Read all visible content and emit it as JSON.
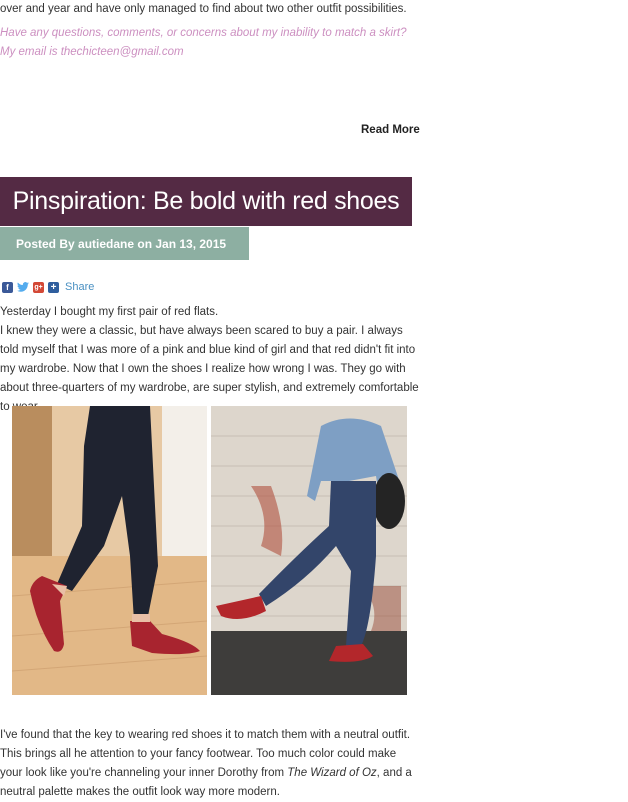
{
  "previous_post": {
    "text_tail": "over and year and have only managed to find about two other outfit possibilities.",
    "contact_text": "Have any questions, comments, or concerns about my inability to match a skirt? My email is thechicteen@gmail.com",
    "read_more_label": "Read More"
  },
  "post": {
    "title": "Pinspiration: Be bold with red shoes",
    "posted_by": "Posted By autiedane on Jan 13, 2015",
    "share": {
      "label": "Share",
      "icons": [
        "facebook-icon",
        "twitter-icon",
        "google-plus-icon",
        "addthis-plus-icon"
      ]
    },
    "body": [
      "Yesterday I bought my first pair of red flats.",
      "I knew they were a classic, but have always been scared to buy a pair. I always told myself that I was more of a pink and blue kind of girl and that red didn't fit into my wardrobe. Now that I own the shoes I realize how wrong I was. They go with about three-quarters of my wardrobe, are super stylish, and extremely comfortable to wear."
    ],
    "closing": {
      "before_title": "I've found that the key to wearing red shoes it to match them with a neutral outfit. This brings all he attention to your fancy footwear. Too much color could make your look like you're channeling your inner Dorothy from ",
      "movie_title": "The Wizard of Oz",
      "after_title": ", and a neutral palette makes the outfit look way more modern."
    }
  },
  "colors": {
    "title_bar": "#542a44",
    "posted_bar": "#8dafa2",
    "contact_text": "#cc8fc0",
    "share_link": "#4a90c2"
  }
}
